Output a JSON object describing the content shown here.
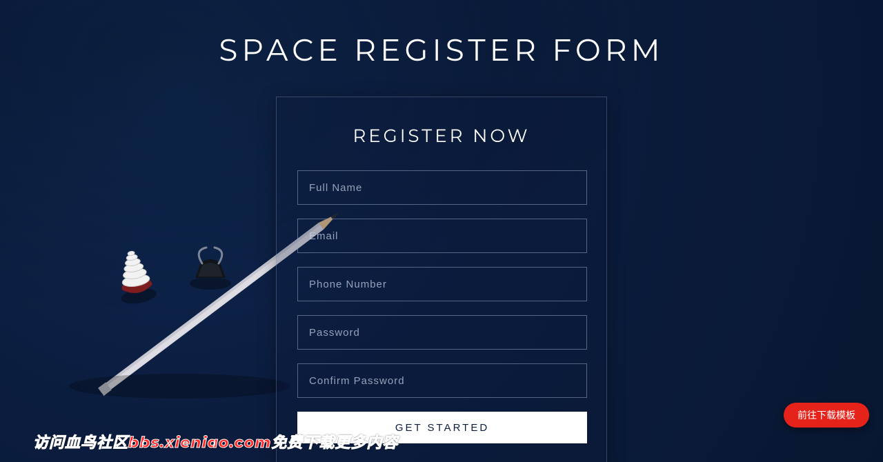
{
  "page": {
    "title": "SPACE REGISTER FORM"
  },
  "card": {
    "title": "REGISTER NOW"
  },
  "form": {
    "full_name_placeholder": "Full Name",
    "email_placeholder": "Email",
    "phone_placeholder": "Phone Number",
    "password_placeholder": "Password",
    "confirm_password_placeholder": "Confirm Password",
    "submit_label": "GET STARTED"
  },
  "floating_button": {
    "label": "前往下载模板"
  },
  "watermark": {
    "text": "访问血鸟社区bbs.xieniao.com免费下载更多内容"
  }
}
